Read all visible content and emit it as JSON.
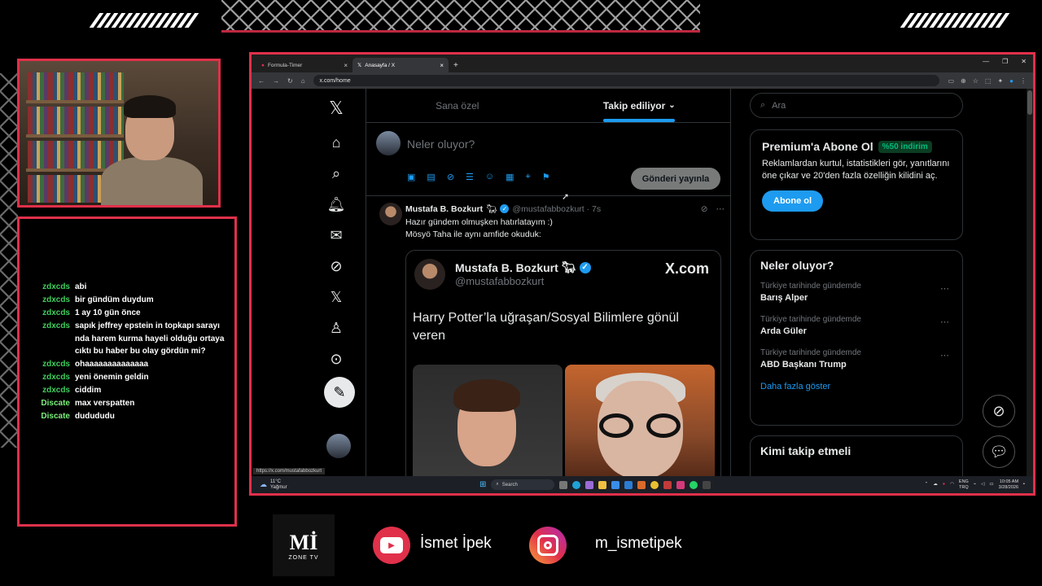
{
  "chat": {
    "messages": [
      {
        "user": "zdxcds",
        "text": "abi",
        "color": "#3ecf5c"
      },
      {
        "user": "zdxcds",
        "text": "bir gündüm duydum",
        "color": "#3ecf5c"
      },
      {
        "user": "zdxcds",
        "text": "1 ay 10 gün önce",
        "color": "#3ecf5c"
      },
      {
        "user": "zdxcds",
        "text": "sapık jeffrey epstein in topkapı sarayı nda harem kurma hayeli olduğu ortaya cıktı bu haber bu olay gördün mi?",
        "color": "#3ecf5c"
      },
      {
        "user": "zdxcds",
        "text": "ohaaaaaaaaaaaaaa",
        "color": "#3ecf5c"
      },
      {
        "user": "zdxcds",
        "text": "yeni önemin geldin",
        "color": "#3ecf5c"
      },
      {
        "user": "zdxcds",
        "text": "ciddim",
        "color": "#3ecf5c"
      },
      {
        "user": "Discate",
        "text": "max verspatten",
        "color": "#7cf07c"
      },
      {
        "user": "Discate",
        "text": "dudududu",
        "color": "#7cf07c"
      }
    ]
  },
  "browser": {
    "tabs": [
      {
        "label": "Formula-Timer",
        "active": false
      },
      {
        "label": "Anasayfa / X",
        "active": true
      }
    ],
    "url": "x.com/home",
    "status_url": "https://x.com/mustafabbozkurt"
  },
  "feed": {
    "tab_for_you": "Sana özel",
    "tab_following": "Takip ediliyor",
    "composer_placeholder": "Neler oluyor?",
    "post_button": "Gönderi yayınla"
  },
  "tweet": {
    "name": "Mustafa B. Bozkurt",
    "handle": "@mustafabbozkurt · 7s",
    "text_line1": "Hazır gündem olmuşken hatırlatayım :)",
    "text_line2": "Mösyö Taha ile aynı amfide okuduk:",
    "embed_name": "Mustafa B. Bozkurt",
    "embed_handle": "@mustafabbozkurt",
    "embed_logo": "X.com",
    "embed_text": "Harry Potter’la uğraşan/Sosyal Bilimlere gönül veren"
  },
  "sidebar": {
    "search_placeholder": "Ara",
    "premium_title": "Premium'a Abone Ol",
    "premium_badge": "%50 indirim",
    "premium_desc": "Reklamlardan kurtul, istatistikleri gör, yanıtlarını öne çıkar ve 20'den fazla özelliğin kilidini aç.",
    "premium_button": "Abone ol",
    "trends_title": "Neler oluyor?",
    "trends": [
      {
        "context": "Türkiye tarihinde gündemde",
        "name": "Barış Alper"
      },
      {
        "context": "Türkiye tarihinde gündemde",
        "name": "Arda Güler"
      },
      {
        "context": "Türkiye tarihinde gündemde",
        "name": "ABD Başkanı Trump"
      }
    ],
    "show_more": "Daha fazla göster",
    "who_to_follow": "Kimi takip etmeli"
  },
  "taskbar": {
    "temp": "11°C",
    "weather": "Yağmur",
    "search": "Search",
    "lang1": "ENG",
    "lang2": "TRQ",
    "time": "10:05 AM",
    "date": "3/28/2026"
  },
  "footer": {
    "logo_main": "Mİ",
    "logo_sub": "ZONE TV",
    "youtube": "İsmet İpek",
    "instagram": "m_ismetipek"
  },
  "colors": {
    "accent": "#e0304a",
    "x_blue": "#1d9bf0"
  }
}
